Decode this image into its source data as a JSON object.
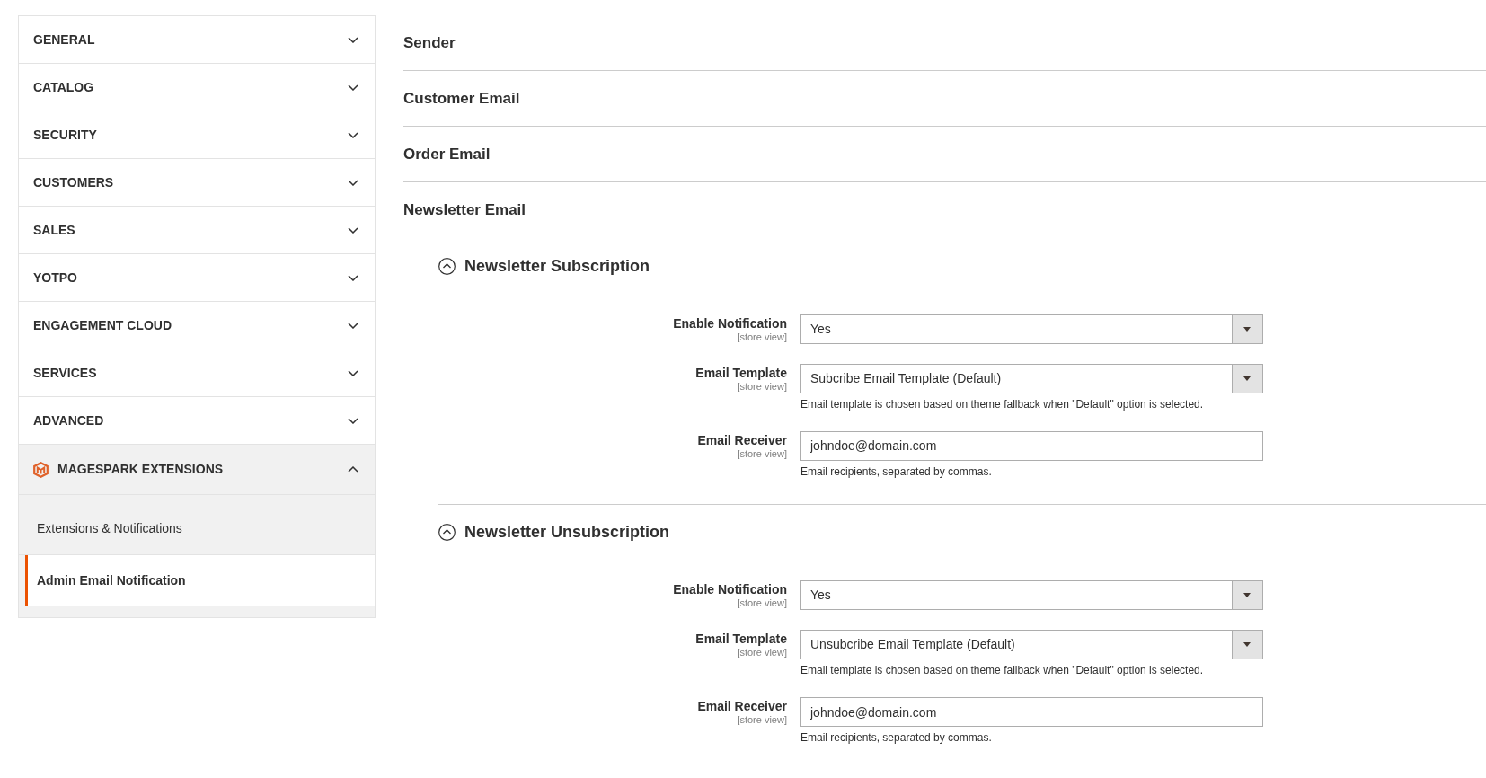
{
  "sidebar": {
    "items": [
      {
        "label": "GENERAL",
        "kind": "section",
        "expanded": false
      },
      {
        "label": "CATALOG",
        "kind": "section",
        "expanded": false
      },
      {
        "label": "SECURITY",
        "kind": "section",
        "expanded": false
      },
      {
        "label": "CUSTOMERS",
        "kind": "section",
        "expanded": false
      },
      {
        "label": "SALES",
        "kind": "section",
        "expanded": false
      },
      {
        "label": "YOTPO",
        "kind": "section",
        "expanded": false
      },
      {
        "label": "ENGAGEMENT CLOUD",
        "kind": "section",
        "expanded": false
      },
      {
        "label": "SERVICES",
        "kind": "section",
        "expanded": false
      },
      {
        "label": "ADVANCED",
        "kind": "section",
        "expanded": false
      },
      {
        "label": "MAGESPARK EXTENSIONS",
        "kind": "vendor",
        "expanded": true,
        "children": [
          {
            "label": "Extensions & Notifications",
            "selected": false
          },
          {
            "label": "Admin Email Notification",
            "selected": true
          }
        ]
      }
    ]
  },
  "sections": [
    {
      "title": "Sender",
      "expanded": false
    },
    {
      "title": "Customer Email",
      "expanded": false
    },
    {
      "title": "Order Email",
      "expanded": false
    },
    {
      "title": "Newsletter Email",
      "expanded": true,
      "groups": [
        {
          "title": "Newsletter Subscription",
          "expanded": true,
          "fields": [
            {
              "kind": "select",
              "label": "Enable Notification",
              "scope": "[store view]",
              "value": "Yes"
            },
            {
              "kind": "select",
              "label": "Email Template",
              "scope": "[store view]",
              "value": "Subcribe Email Template (Default)",
              "note": "Email template is chosen based on theme fallback when \"Default\" option is selected."
            },
            {
              "kind": "text",
              "label": "Email Receiver",
              "scope": "[store view]",
              "value": "johndoe@domain.com",
              "note": "Email recipients, separated by commas."
            }
          ]
        },
        {
          "title": "Newsletter Unsubscription",
          "expanded": true,
          "fields": [
            {
              "kind": "select",
              "label": "Enable Notification",
              "scope": "[store view]",
              "value": "Yes"
            },
            {
              "kind": "select",
              "label": "Email Template",
              "scope": "[store view]",
              "value": "Unsubcribe Email Template (Default)",
              "note": "Email template is chosen based on theme fallback when \"Default\" option is selected."
            },
            {
              "kind": "text",
              "label": "Email Receiver",
              "scope": "[store view]",
              "value": "johndoe@domain.com",
              "note": "Email recipients, separated by commas."
            }
          ]
        }
      ]
    }
  ]
}
